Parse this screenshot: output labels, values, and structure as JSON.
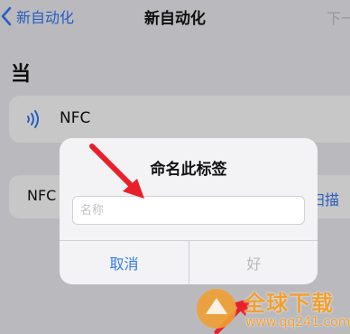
{
  "nav": {
    "back_label": "新自动化",
    "title": "新自动化",
    "next_label": "下一"
  },
  "section": {
    "title": "当"
  },
  "nfc_row": {
    "label": "NFC",
    "icon": "nfc-icon"
  },
  "tag_row": {
    "label": "NFC",
    "scan_label": "扫描"
  },
  "dialog": {
    "title": "命名此标签",
    "input_placeholder": "名称",
    "input_value": "",
    "cancel_label": "取消",
    "ok_label": "好"
  },
  "watermark": {
    "text": "全球下载",
    "url": "www.qq241.com"
  },
  "colors": {
    "accent": "#3478f6",
    "arrow": "#e8202a",
    "watermark": "#f0a033"
  }
}
